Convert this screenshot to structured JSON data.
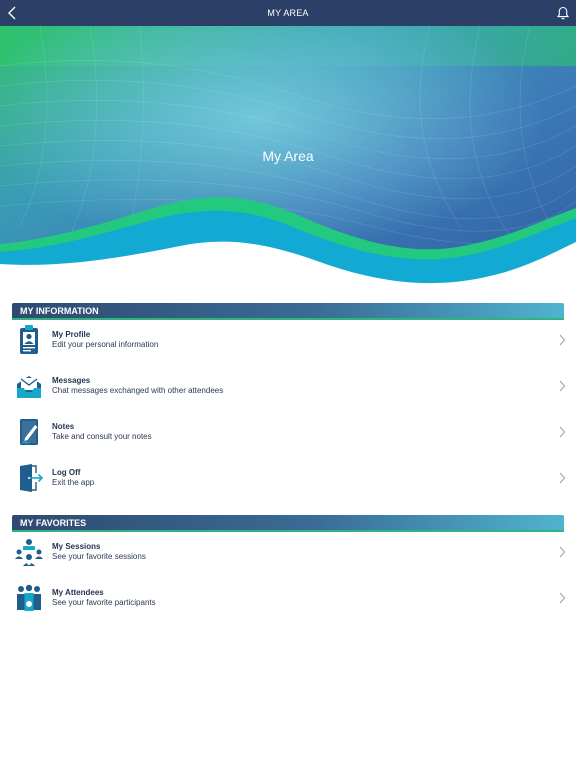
{
  "topbar": {
    "title": "MY AREA"
  },
  "hero": {
    "title": "My Area"
  },
  "sections": {
    "information": {
      "title": "MY INFORMATION",
      "items": [
        {
          "label": "My Profile",
          "subtitle": "Edit your personal information",
          "icon": "profile-badge-icon"
        },
        {
          "label": "Messages",
          "subtitle": "Chat messages exchanged with other attendees",
          "icon": "inbox-icon"
        },
        {
          "label": "Notes",
          "subtitle": "Take and consult your notes",
          "icon": "notepad-icon"
        },
        {
          "label": "Log Off",
          "subtitle": "Exit the app",
          "icon": "logout-door-icon"
        }
      ]
    },
    "favorites": {
      "title": "MY FAVORITES",
      "items": [
        {
          "label": "My Sessions",
          "subtitle": "See your favorite sessions",
          "icon": "sessions-icon"
        },
        {
          "label": "My Attendees",
          "subtitle": "See your favorite participants",
          "icon": "attendees-icon"
        }
      ]
    }
  },
  "colors": {
    "topbar": "#2c3f66",
    "icon": "#1f5d8c",
    "icon_accent": "#17a7c8",
    "wave_green": "#1fc87f",
    "wave_blue": "#12a8d2"
  }
}
